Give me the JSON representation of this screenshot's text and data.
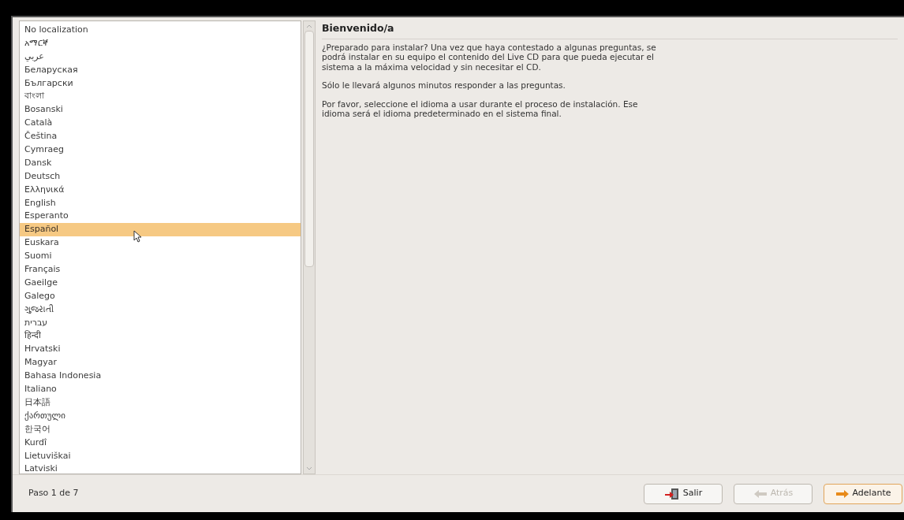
{
  "languages": [
    {
      "label": "No localization",
      "selected": false
    },
    {
      "label": "አማርኛ",
      "selected": false
    },
    {
      "label": "عربي",
      "selected": false
    },
    {
      "label": "Беларуская",
      "selected": false
    },
    {
      "label": "Български",
      "selected": false
    },
    {
      "label": "বাংলা",
      "selected": false
    },
    {
      "label": "Bosanski",
      "selected": false
    },
    {
      "label": "Català",
      "selected": false
    },
    {
      "label": "Čeština",
      "selected": false
    },
    {
      "label": "Cymraeg",
      "selected": false
    },
    {
      "label": "Dansk",
      "selected": false
    },
    {
      "label": "Deutsch",
      "selected": false
    },
    {
      "label": "Ελληνικά",
      "selected": false
    },
    {
      "label": "English",
      "selected": false
    },
    {
      "label": "Esperanto",
      "selected": false
    },
    {
      "label": "Español",
      "selected": true
    },
    {
      "label": "Euskara",
      "selected": false
    },
    {
      "label": "Suomi",
      "selected": false
    },
    {
      "label": "Français",
      "selected": false
    },
    {
      "label": "Gaeilge",
      "selected": false
    },
    {
      "label": "Galego",
      "selected": false
    },
    {
      "label": "ગુજરાતી",
      "selected": false
    },
    {
      "label": "עברית",
      "selected": false
    },
    {
      "label": "हिन्दी",
      "selected": false
    },
    {
      "label": "Hrvatski",
      "selected": false
    },
    {
      "label": "Magyar",
      "selected": false
    },
    {
      "label": "Bahasa Indonesia",
      "selected": false
    },
    {
      "label": "Italiano",
      "selected": false
    },
    {
      "label": "日本語",
      "selected": false
    },
    {
      "label": "ქართული",
      "selected": false
    },
    {
      "label": "한국어",
      "selected": false
    },
    {
      "label": "Kurdî",
      "selected": false
    },
    {
      "label": "Lietuviškai",
      "selected": false
    },
    {
      "label": "Latviski",
      "selected": false
    }
  ],
  "welcome": {
    "title": "Bienvenido/a",
    "paragraphs": [
      "¿Preparado para instalar? Una vez que haya contestado a algunas preguntas, se podrá instalar en su equipo el contenido del Live CD para que pueda ejecutar el sistema a la máxima velocidad y sin necesitar el CD.",
      "Sólo le llevará algunos minutos responder a las preguntas.",
      "Por favor, seleccione el idioma a usar durante el proceso de instalación. Ese idioma será el idioma predeterminado en el sistema final."
    ]
  },
  "step": "Paso 1 de 7",
  "buttons": [
    {
      "kind": "quit",
      "label": "Salir",
      "disabled": false,
      "default": false
    },
    {
      "kind": "back",
      "label": "Atrás",
      "disabled": true,
      "default": false
    },
    {
      "kind": "forward",
      "label": "Adelante",
      "disabled": false,
      "default": true
    }
  ]
}
